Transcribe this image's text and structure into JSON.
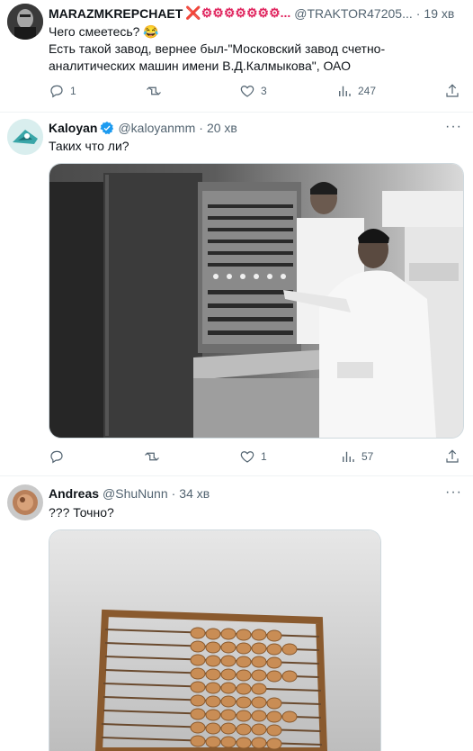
{
  "tweets": [
    {
      "name": "MARAZMKREPCHAET",
      "name_suffix": "❌⚙⚙⚙⚙⚙⚙⚙...",
      "handle": "@TRAKTOR47205...",
      "time": "19 хв",
      "text": "Чего смеетесь? 😂\nЕсть такой завод, вернее был-\"Московский завод счетно-аналитических машин имени В.Д.Калмыкова\", ОАО",
      "replies": "1",
      "retweets": "",
      "likes": "3",
      "views": "247"
    },
    {
      "name": "Kaloyan",
      "handle": "@kaloyanmm",
      "time": "20 хв",
      "text": "Таких что ли?",
      "replies": "",
      "retweets": "",
      "likes": "1",
      "views": "57"
    },
    {
      "name": "Andreas",
      "handle": "@ShuNunn",
      "time": "34 хв",
      "text": "??? Точно?"
    }
  ],
  "icons": {
    "reply": "reply-icon",
    "retweet": "retweet-icon",
    "like": "heart-icon",
    "views": "views-icon",
    "share": "share-icon",
    "more": "more-icon",
    "verified": "verified-badge-icon"
  },
  "colors": {
    "text": "#0f1419",
    "secondary": "#536471",
    "divider": "#eff3f4",
    "verified": "#1d9bf0",
    "x_mark": "#e0245e"
  }
}
